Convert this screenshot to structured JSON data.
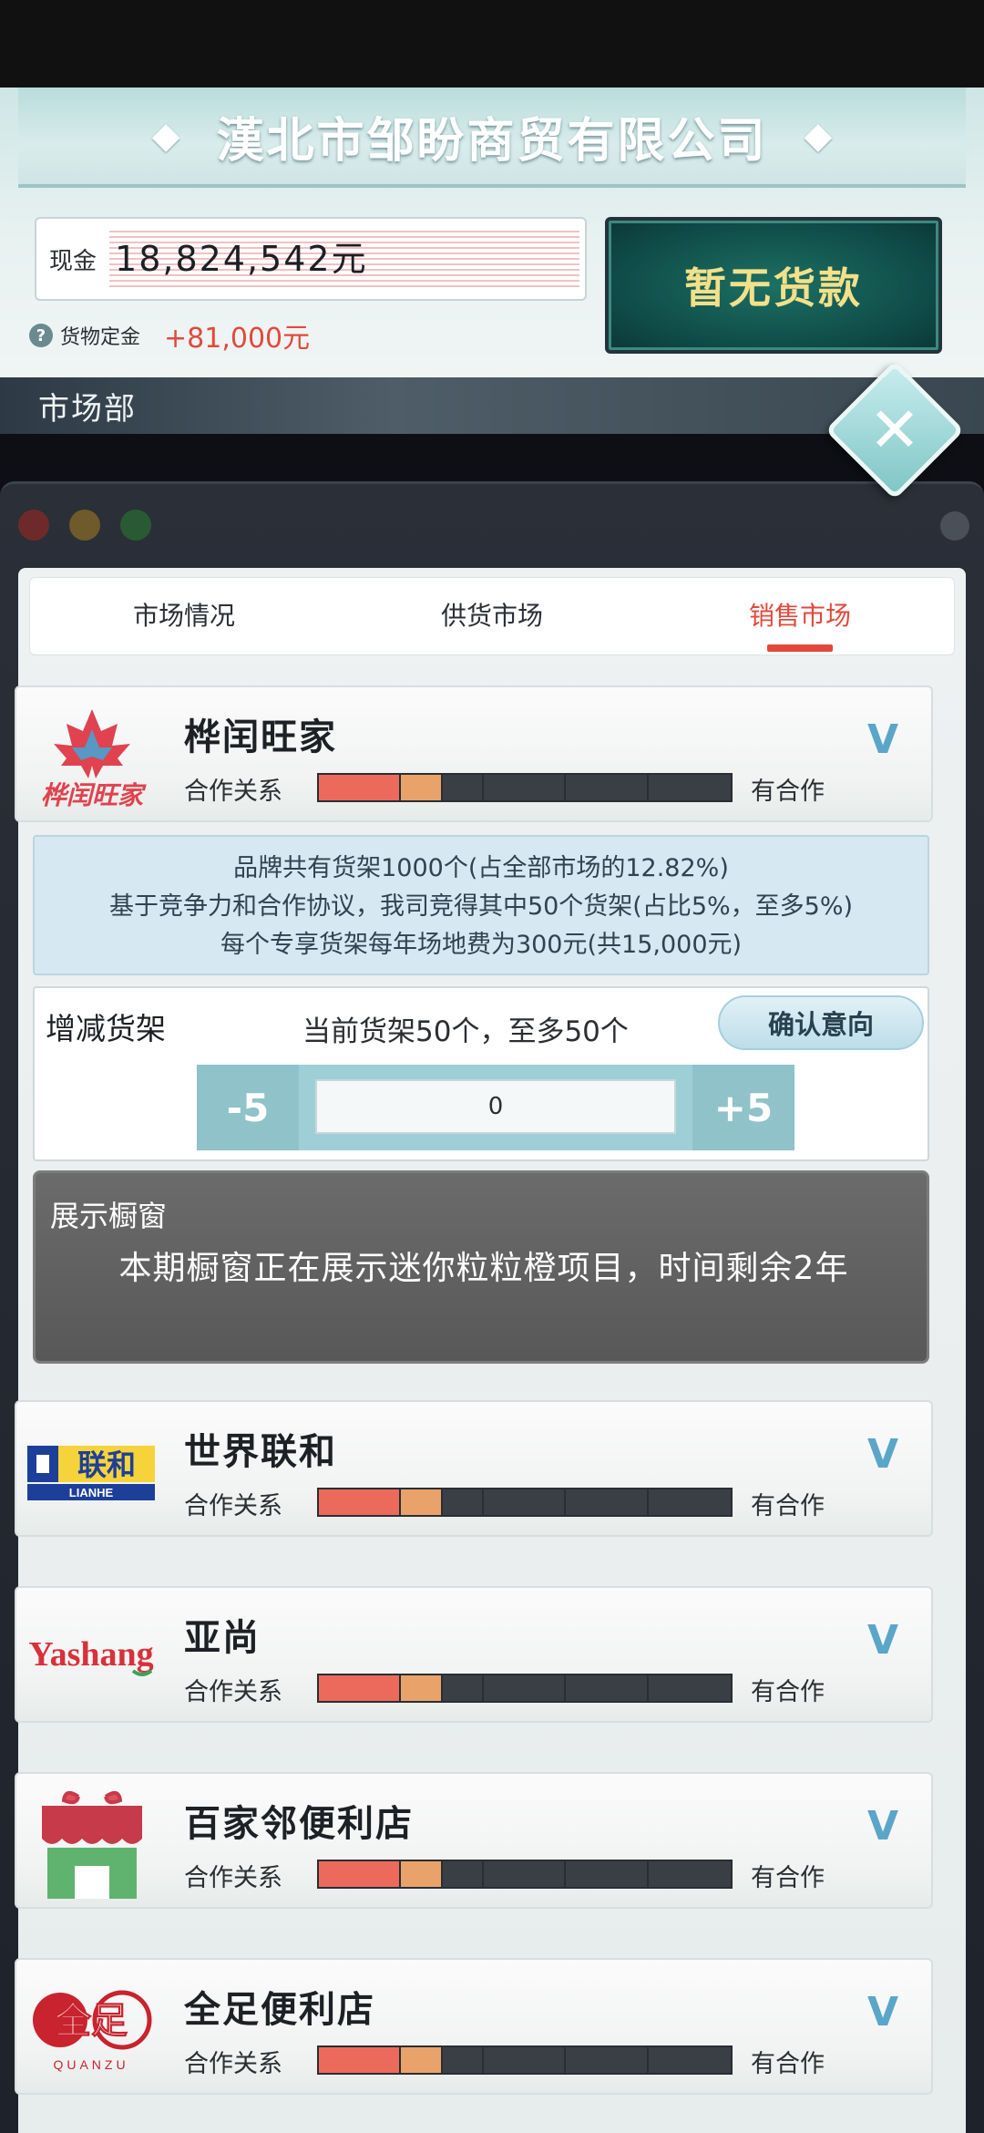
{
  "header": {
    "company_name": "漢北市邹盼商贸有限公司",
    "diamond_glyph": "◆",
    "cash_label": "现金",
    "cash_value": "18,824,542元",
    "deposit_help_glyph": "?",
    "deposit_label": "货物定金",
    "deposit_value": "+81,000元",
    "loan_label": "暂无货款",
    "department": "市场部",
    "close_glyph": "✕"
  },
  "tabs": [
    {
      "label": "市场情况",
      "active": false
    },
    {
      "label": "供货市场",
      "active": false
    },
    {
      "label": "销售市场",
      "active": true
    }
  ],
  "relation_label": "合作关系",
  "relation_value": "有合作",
  "relation_level": 0.4,
  "chevron_glyph": "V",
  "companies": [
    {
      "name": "桦闰旺家",
      "logo_text": "桦闰旺家",
      "logo": "maple-leaf-icon",
      "expanded": true
    },
    {
      "name": "世界联和",
      "logo_text": "联和",
      "logo_sub": "LIANHE",
      "logo": "lianhe-logo"
    },
    {
      "name": "亚尚",
      "logo_text": "Yashang",
      "logo": "yashang-logo"
    },
    {
      "name": "百家邻便利店",
      "logo": "store-front-icon"
    },
    {
      "name": "全足便利店",
      "logo_text": "全足",
      "logo_sub": "QUANZU",
      "logo": "quanzu-logo"
    }
  ],
  "expanded": {
    "info_lines": [
      "品牌共有货架1000个(占全部市场的12.82%)",
      "基于竞争力和合作协议，我司竞得其中50个货架(占比5%，至多5%)",
      "每个专享货架每年场地费为300元(共15,000元)"
    ],
    "shelf_label": "增减货架",
    "shelf_status": "当前货架50个，至多50个",
    "confirm_label": "确认意向",
    "minus_label": "-5",
    "plus_label": "+5",
    "stepper_value": "0",
    "showcase_title": "展示橱窗",
    "showcase_text": "本期橱窗正在展示迷你粒粒橙项目，时间剩余2年"
  },
  "colors": {
    "accent_red": "#e2493b",
    "relation_red": "#ec6a5c",
    "relation_orange": "#e9a36a",
    "loan_text": "#f3e089"
  }
}
